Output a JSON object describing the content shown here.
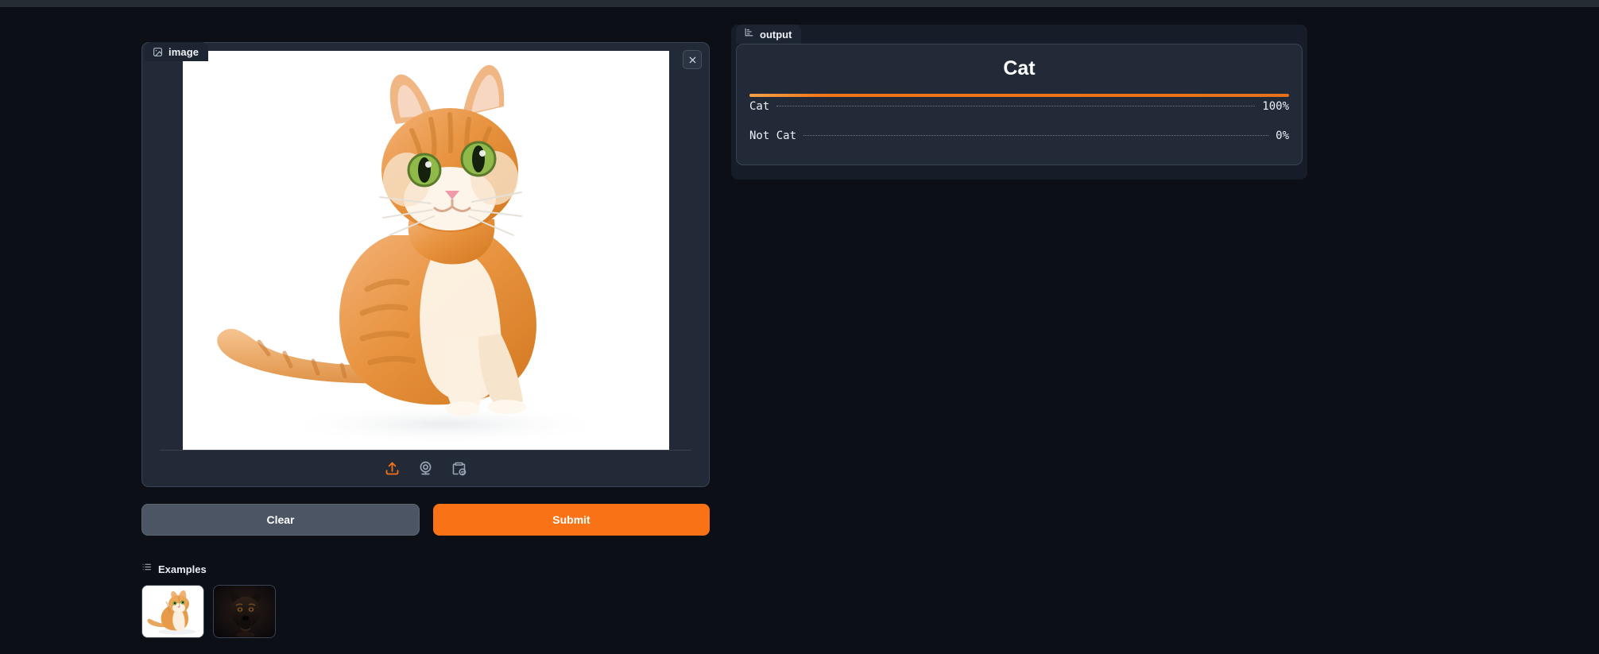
{
  "app": {
    "background": "#0d0f17",
    "accent": "#f97316"
  },
  "input_panel": {
    "tab_label": "image",
    "tab_icon": "image-icon",
    "close_icon": "close-icon",
    "photo_alt": "orange tabby cat sitting on white background",
    "tools": [
      {
        "name": "upload-icon",
        "label": "Upload",
        "active": true
      },
      {
        "name": "webcam-icon",
        "label": "Webcam",
        "active": false
      },
      {
        "name": "paste-clipboard-icon",
        "label": "Paste from clipboard",
        "active": false
      }
    ]
  },
  "actions": {
    "clear_label": "Clear",
    "submit_label": "Submit"
  },
  "examples": {
    "header_label": "Examples",
    "header_icon": "list-icon",
    "items": [
      {
        "name": "example-cat",
        "alt": "orange cat on white background",
        "theme": "light"
      },
      {
        "name": "example-dog",
        "alt": "doberman dog on black background",
        "theme": "dark"
      }
    ]
  },
  "output_panel": {
    "tab_label": "output",
    "tab_icon": "label-chart-icon",
    "title": "Cat",
    "results": [
      {
        "label": "Cat",
        "value": "100%",
        "percent": 100
      },
      {
        "label": "Not Cat",
        "value": "0%",
        "percent": 0
      }
    ]
  }
}
